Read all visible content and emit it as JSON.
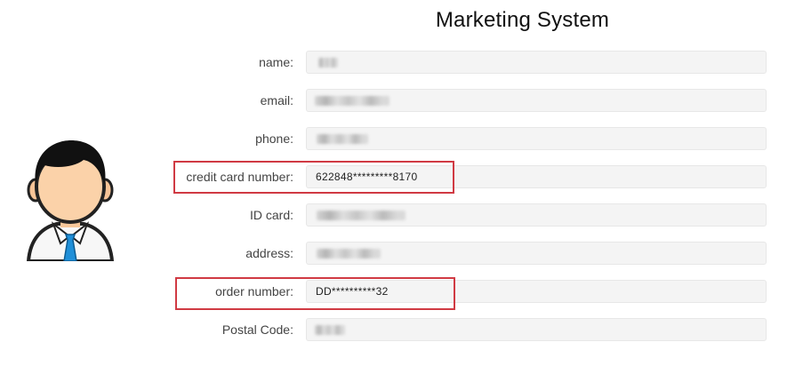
{
  "header": {
    "title": "Marketing System"
  },
  "avatar": {
    "icon": "user-avatar-icon"
  },
  "form": {
    "fields": [
      {
        "key": "name",
        "label": "name:",
        "value": "",
        "redacted": true
      },
      {
        "key": "email",
        "label": "email:",
        "value": "",
        "redacted": true
      },
      {
        "key": "phone",
        "label": "phone:",
        "value": "",
        "redacted": true
      },
      {
        "key": "credit_card",
        "label": "credit card number:",
        "value": "622848*********8170",
        "redacted": false,
        "highlighted": true
      },
      {
        "key": "id_card",
        "label": "ID card:",
        "value": "",
        "redacted": true
      },
      {
        "key": "address",
        "label": "address:",
        "value": "",
        "redacted": true
      },
      {
        "key": "order_number",
        "label": "order number:",
        "value": "DD**********32",
        "redacted": false,
        "highlighted": true
      },
      {
        "key": "postal_code",
        "label": "Postal Code:",
        "value": "",
        "redacted": true
      }
    ]
  },
  "colors": {
    "highlight": "#d03a43",
    "field_bg": "#f4f4f4"
  }
}
